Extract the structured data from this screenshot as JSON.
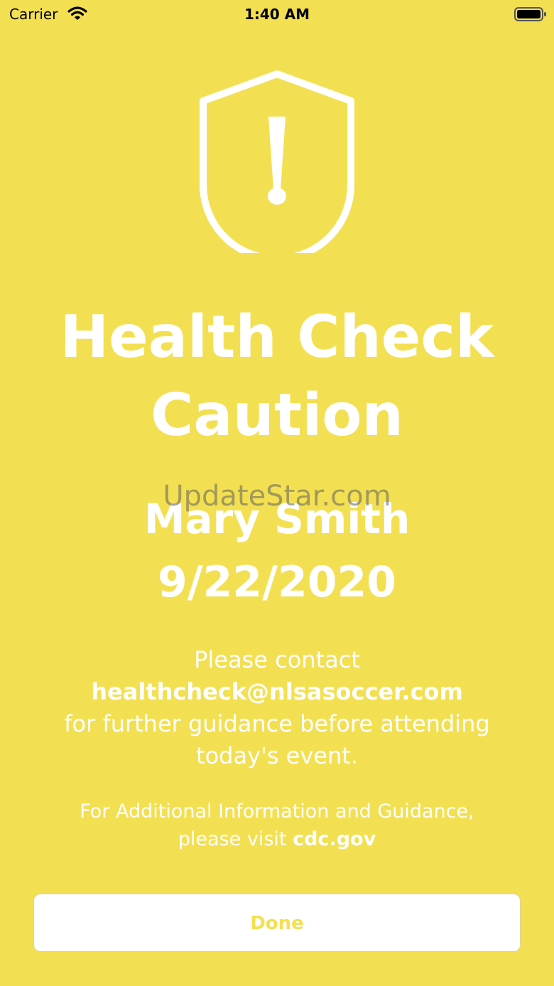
{
  "status_bar": {
    "carrier": "Carrier",
    "time": "1:40 AM"
  },
  "title": {
    "line1": "Health Check",
    "line2": "Caution"
  },
  "watermark": "UpdateStar.com",
  "person": {
    "name": "Mary Smith",
    "date": "9/22/2020"
  },
  "message": {
    "line1": "Please contact",
    "email": "healthcheck@nlsasoccer.com",
    "line3": "for further guidance before attending",
    "line4": "today's event."
  },
  "info": {
    "line1": "For Additional Information and Guidance,",
    "prefix": "please visit ",
    "link": "cdc.gov"
  },
  "done_label": "Done",
  "colors": {
    "background": "#f3e052",
    "text": "#ffffff",
    "button_text": "#f3e052"
  },
  "icons": {
    "status": "caution-shield-icon"
  }
}
